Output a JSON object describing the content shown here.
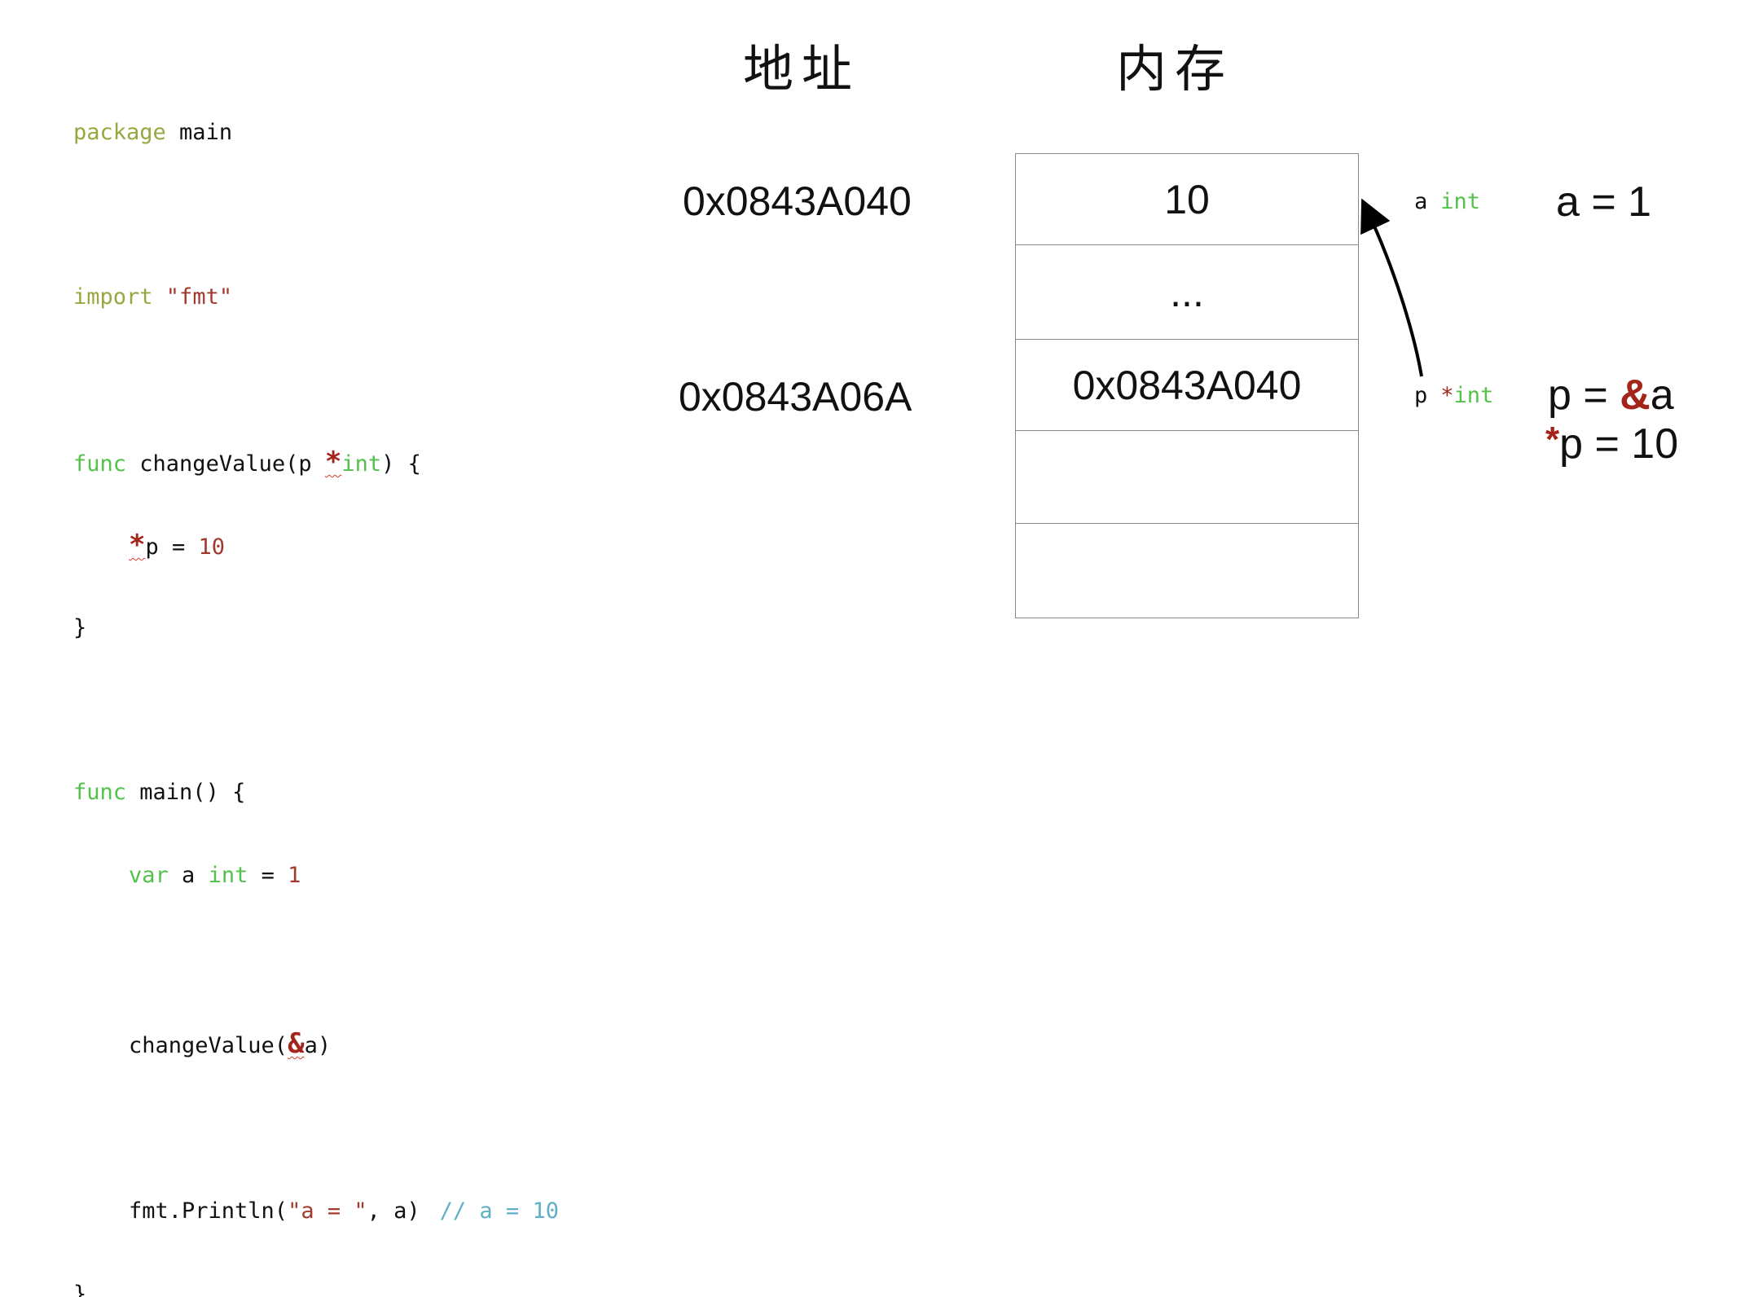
{
  "headers": {
    "address": "地址",
    "memory": "内存"
  },
  "code": {
    "l1_kw": "package",
    "l1_rest": " main",
    "l2_kw": "import",
    "l2_str": " \"fmt\"",
    "l3_kw": "func",
    "l3_a": " changeValue(p ",
    "l3_star": "*",
    "l3_type": "int",
    "l3_b": ") {",
    "l4_star": "*",
    "l4_a": "p = ",
    "l4_num": "10",
    "l5": "}",
    "l6_kw": "func",
    "l6_rest": " main() {",
    "l7_kw": "var",
    "l7_a": " a ",
    "l7_type": "int",
    "l7_b": " = ",
    "l7_num": "1",
    "l8_a": "changeValue(",
    "l8_amp": "&",
    "l8_b": "a)",
    "l9_a": "fmt.Println(",
    "l9_str": "\"a = \"",
    "l9_b": ", a)",
    "l9_comment": "// a = 10",
    "l10": "}"
  },
  "addresses": {
    "a": "0x0843A040",
    "p": "0x0843A06A"
  },
  "memory_cells": [
    "10",
    "...",
    "0x0843A040",
    "",
    ""
  ],
  "labels": {
    "a_name": "a",
    "a_type": "int",
    "p_name": "p",
    "p_star": "*",
    "p_type": "int"
  },
  "expressions": {
    "a_assign": "a = 1",
    "p_lhs": "p = ",
    "p_amp": "&",
    "p_rhs": "a",
    "deref_star": "*",
    "deref_rest": "p = 10"
  },
  "colors": {
    "keyword_olive": "#9aa640",
    "type_green": "#52c24a",
    "literal_red": "#a33a2e",
    "operator_red": "#a3241b",
    "comment_teal": "#5fb0c4"
  }
}
